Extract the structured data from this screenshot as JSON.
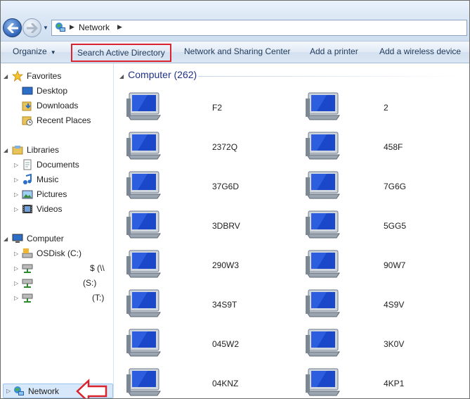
{
  "breadcrumb": {
    "location": "Network"
  },
  "commands": {
    "organize": "Organize",
    "search_ad": "Search Active Directory",
    "network_sharing": "Network and Sharing Center",
    "add_printer": "Add a printer",
    "add_wireless": "Add a wireless device"
  },
  "nav": {
    "favorites": "Favorites",
    "desktop": "Desktop",
    "downloads": "Downloads",
    "recent": "Recent Places",
    "libraries": "Libraries",
    "documents": "Documents",
    "music": "Music",
    "pictures": "Pictures",
    "videos": "Videos",
    "computer": "Computer",
    "osdisk": "OSDisk (C:)",
    "drive1": "$ (\\\\",
    "drive2": "(S:)",
    "drive3": "(T:)",
    "network": "Network"
  },
  "group": {
    "header": "Computer (262)"
  },
  "computers": [
    "F2",
    "2",
    "2372Q",
    "458F",
    "37G6D",
    "7G6G",
    "3DBRV",
    "5GG5",
    "290W3",
    "90W7",
    "34S9T",
    "4S9V",
    "045W2",
    "3K0V",
    "04KNZ",
    "4KP1"
  ],
  "colors": {
    "accent_red": "#d9232e",
    "group_header": "#1e3287"
  }
}
